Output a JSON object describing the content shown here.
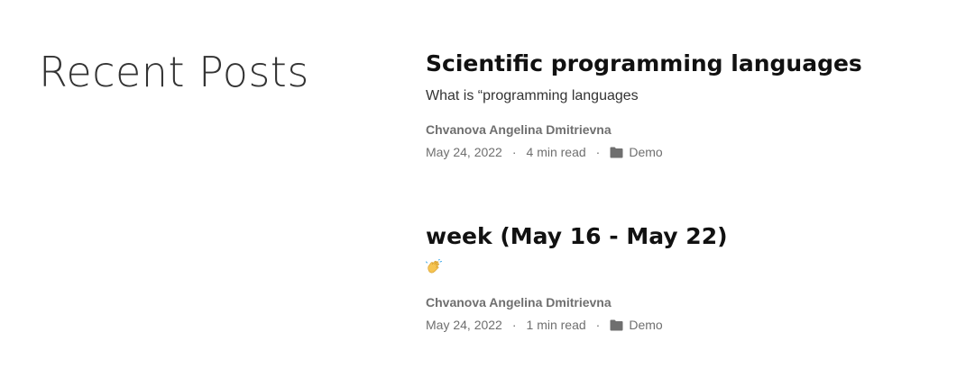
{
  "section": {
    "title": "Recent Posts"
  },
  "posts": [
    {
      "title": "Scientific programming languages",
      "summary": "What is “programming languages",
      "author": "Chvanova Angelina Dmitrievna",
      "date": "May 24, 2022",
      "separator": "·",
      "read_time": "4 min read",
      "category": "Demo",
      "category_icon": "folder-icon"
    },
    {
      "title": "week (May 16 - May 22)",
      "summary_icon": "clapping-hands-emoji",
      "author": "Chvanova Angelina Dmitrievna",
      "date": "May 24, 2022",
      "separator": "·",
      "read_time": "1 min read",
      "category": "Demo",
      "category_icon": "folder-icon"
    }
  ]
}
